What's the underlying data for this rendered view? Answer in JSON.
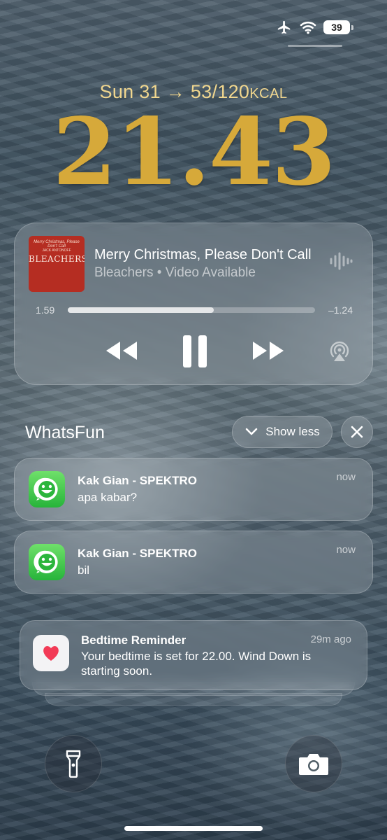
{
  "status_bar": {
    "icons": [
      "airplane-icon",
      "wifi-icon",
      "battery-icon"
    ],
    "battery_level": "39"
  },
  "lock_screen": {
    "date": "Sun 31",
    "activity": "53/120",
    "activity_unit": "KCAL",
    "time": "21.43",
    "accent_color": "#d6a93a"
  },
  "now_playing": {
    "album_art": {
      "top_text": "Merry Christmas, Please Don't Call",
      "artist_text": "JACK ANTONOFF",
      "band_text": "BLEACHERS",
      "color": "#b52d22"
    },
    "title": "Merry Christmas, Please Don't Call",
    "subtitle": "Bleachers • Video Available",
    "elapsed": "1.59",
    "remaining": "–1.24",
    "progress": 0.59,
    "controls": [
      "rewind-icon",
      "pause-icon",
      "fast-forward-icon",
      "airplay-icon"
    ]
  },
  "notification_group": {
    "app_name": "WhatsFun",
    "show_less_label": "Show less",
    "notifications": [
      {
        "title": "Kak Gian - SPEKTRO",
        "body": "apa kabar?",
        "time": "now"
      },
      {
        "title": "Kak Gian - SPEKTRO",
        "body": "bil",
        "time": "now"
      }
    ]
  },
  "bedtime": {
    "title": "Bedtime Reminder",
    "time": "29m ago",
    "body_line1": "Your bedtime is set for 22.00. Wind Down is",
    "body_line2": "starting soon."
  },
  "bottom_controls": [
    "flashlight-icon",
    "camera-icon"
  ]
}
